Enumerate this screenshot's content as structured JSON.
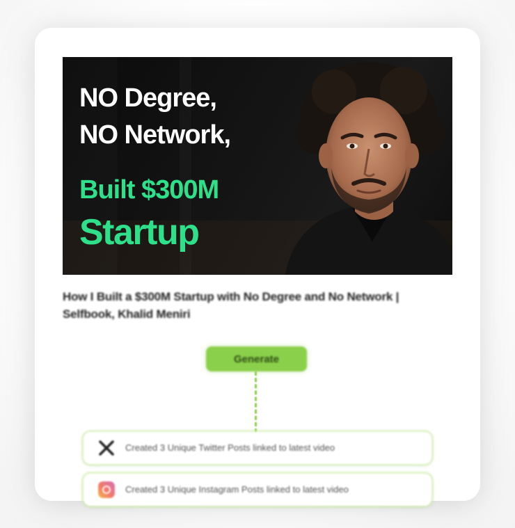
{
  "thumbnail": {
    "line1": "NO Degree,",
    "line2": "NO Network,",
    "line3": "Built $300M",
    "line4": "Startup",
    "accent_color": "#2ee08a"
  },
  "video": {
    "title": "How I Built a $300M Startup with No Degree and No Network | Selfbook, Khalid Meniri"
  },
  "actions": {
    "generate_label": "Generate",
    "button_color": "#8bd04a"
  },
  "results": [
    {
      "icon": "x-logo-icon",
      "text": "Created 3 Unique Twitter Posts linked to latest video"
    },
    {
      "icon": "instagram-icon",
      "text": "Created 3 Unique Instagram Posts linked to latest video"
    }
  ]
}
